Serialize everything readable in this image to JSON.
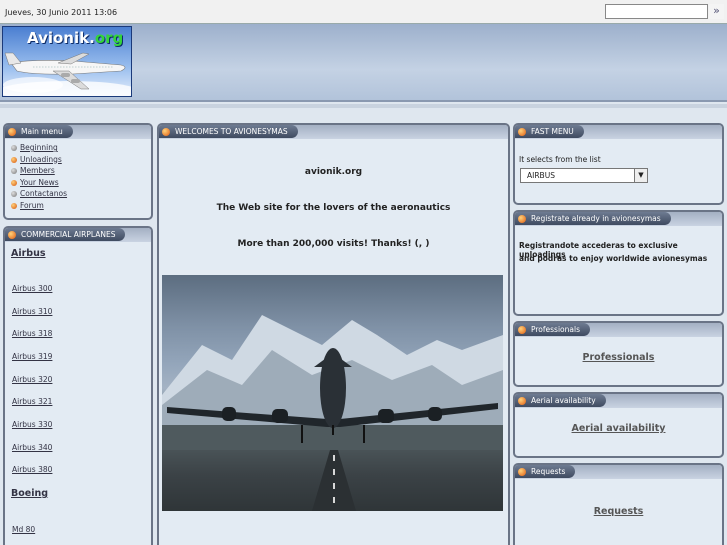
{
  "topbar": {
    "date": "Jueves, 30 Junio 2011 13:06",
    "search_value": "",
    "search_icon": "chevron-right-icon"
  },
  "logo": {
    "name": "Avionik",
    "dot": ".",
    "tld": "org"
  },
  "main_menu": {
    "title": "Main menu",
    "items": [
      {
        "label": "Beginning"
      },
      {
        "label": "Unloadings"
      },
      {
        "label": "Members"
      },
      {
        "label": "Your News"
      },
      {
        "label": "Contactanos"
      },
      {
        "label": "Forum"
      }
    ]
  },
  "airplanes": {
    "title": "COMMERCIAL AIRPLANES",
    "airbus": {
      "label": "Airbus",
      "models": [
        "Airbus 300",
        "Airbus 310",
        "Airbus 318",
        "Airbus 319",
        "Airbus 320",
        "Airbus 321",
        "Airbus 330",
        "Airbus 340",
        "Airbus 380"
      ]
    },
    "boeing": {
      "label": "Boeing",
      "models": [
        "Md 80"
      ]
    }
  },
  "welcome": {
    "title": "WELCOMES TO AVIONESYMAS",
    "site": "avionik.org",
    "tagline": "The Web site for the lovers of the aeronautics",
    "visits": "More than 200,000 visits! Thanks! (, )"
  },
  "fast_menu": {
    "title": "FAST MENU",
    "hint": "It selects from the list",
    "selected": "AIRBUS"
  },
  "register": {
    "title": "Registrate already in avionesymas",
    "line1": "Registrandote accederas to exclusive unloadings",
    "line2": "and podras to enjoy worldwide avionesymas"
  },
  "professionals": {
    "title": "Professionals",
    "link": "Professionals"
  },
  "aerial": {
    "title": "Aerial availability",
    "link": "Aerial availability"
  },
  "requests": {
    "title": "Requests",
    "link": "Requests"
  }
}
